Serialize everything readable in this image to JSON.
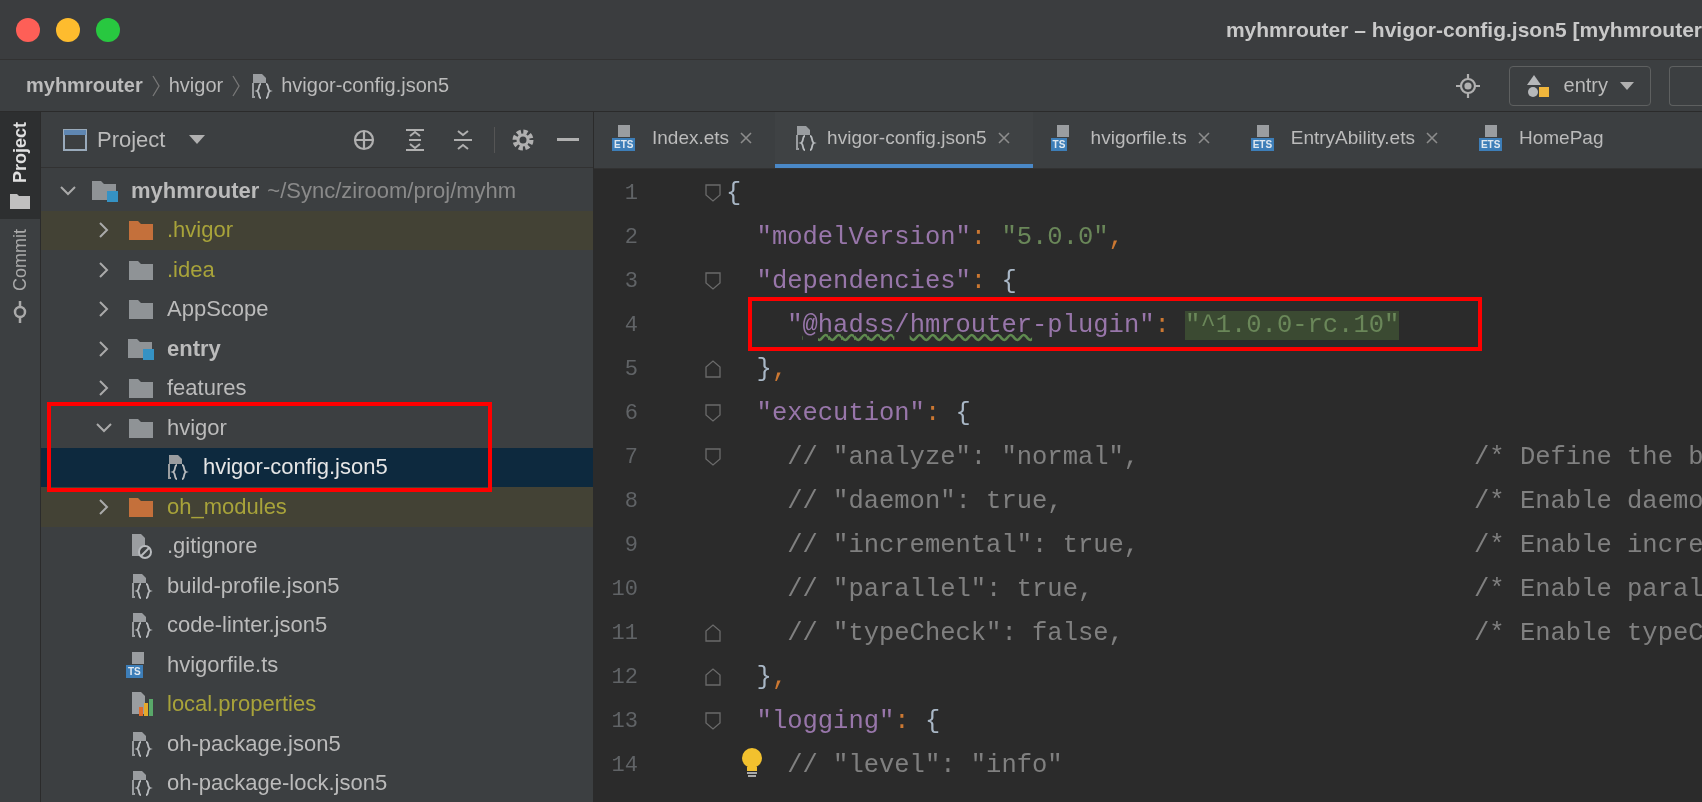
{
  "window": {
    "title": "myhmrouter – hvigor-config.json5 [myhmrouter"
  },
  "breadcrumbs": [
    {
      "label": "myhmrouter",
      "kind": "project"
    },
    {
      "label": "hvigor",
      "kind": "folder"
    },
    {
      "label": "hvigor-config.json5",
      "kind": "json"
    }
  ],
  "run_config": {
    "label": "entry"
  },
  "side_tabs": [
    {
      "label": "Project",
      "kind": "folder",
      "selected": true
    },
    {
      "label": "Commit",
      "kind": "commit",
      "selected": false
    }
  ],
  "project_panel": {
    "title": "Project"
  },
  "tree": [
    {
      "label": "myhmrouter",
      "path": "~/Sync/ziroom/proj/myhm",
      "kind": "module",
      "ignored": false,
      "highlighted": false,
      "selected": false,
      "expanded": true,
      "children": [
        {
          "label": ".hvigor",
          "kind": "excluded",
          "ignored": true,
          "highlighted": true,
          "selected": false,
          "expanded": false
        },
        {
          "label": ".idea",
          "kind": "folder",
          "ignored": true,
          "highlighted": false,
          "selected": false,
          "expanded": false
        },
        {
          "label": "AppScope",
          "kind": "folder",
          "ignored": false,
          "highlighted": false,
          "selected": false,
          "expanded": false
        },
        {
          "label": "entry",
          "kind": "module",
          "ignored": false,
          "highlighted": false,
          "selected": false,
          "expanded": false
        },
        {
          "label": "features",
          "kind": "folder",
          "ignored": false,
          "highlighted": false,
          "selected": false,
          "expanded": false
        },
        {
          "label": "hvigor",
          "kind": "folder",
          "ignored": false,
          "highlighted": false,
          "selected": false,
          "expanded": true,
          "children": [
            {
              "label": "hvigor-config.json5",
              "kind": "json",
              "ignored": false,
              "highlighted": false,
              "selected": true
            }
          ]
        },
        {
          "label": "oh_modules",
          "kind": "excluded",
          "ignored": true,
          "highlighted": true,
          "selected": false,
          "expanded": false
        },
        {
          "label": ".gitignore",
          "kind": "gitignore",
          "ignored": false,
          "highlighted": false,
          "selected": false
        },
        {
          "label": "build-profile.json5",
          "kind": "json",
          "ignored": false,
          "highlighted": false,
          "selected": false
        },
        {
          "label": "code-linter.json5",
          "kind": "json",
          "ignored": false,
          "highlighted": false,
          "selected": false
        },
        {
          "label": "hvigorfile.ts",
          "kind": "ts",
          "badge": "TS",
          "ignored": false,
          "highlighted": false,
          "selected": false
        },
        {
          "label": "local.properties",
          "kind": "properties",
          "ignored": true,
          "highlighted": false,
          "selected": false
        },
        {
          "label": "oh-package.json5",
          "kind": "json",
          "ignored": false,
          "highlighted": false,
          "selected": false
        },
        {
          "label": "oh-package-lock.json5",
          "kind": "json",
          "ignored": false,
          "highlighted": false,
          "selected": false
        }
      ]
    }
  ],
  "tabs": [
    {
      "label": "Index.ets",
      "kind": "ets",
      "badge": "ETS",
      "closable": true,
      "selected": false
    },
    {
      "label": "hvigor-config.json5",
      "kind": "json",
      "closable": true,
      "selected": true
    },
    {
      "label": "hvigorfile.ts",
      "kind": "ts",
      "badge": "TS",
      "closable": true,
      "selected": false
    },
    {
      "label": "EntryAbility.ets",
      "kind": "ets",
      "badge": "ETS",
      "closable": true,
      "selected": false
    },
    {
      "label": "HomePag",
      "kind": "ets",
      "badge": "ETS",
      "closable": false,
      "selected": false
    }
  ],
  "editor": {
    "lines": [
      {
        "number": "1",
        "fold_start": true,
        "tokens": [
          {
            "kind": "brace",
            "text": "{"
          }
        ]
      },
      {
        "number": "2",
        "tokens": [
          {
            "kind": "key",
            "text": "  \"modelVersion\""
          },
          {
            "kind": "punct",
            "text": ": "
          },
          {
            "kind": "string",
            "text": "\"5.0.0\""
          },
          {
            "kind": "punct",
            "text": ","
          }
        ]
      },
      {
        "number": "3",
        "fold_start": true,
        "tokens": [
          {
            "kind": "key",
            "text": "  \"dependencies\""
          },
          {
            "kind": "punct",
            "text": ": "
          },
          {
            "kind": "brace",
            "text": "{"
          }
        ]
      },
      {
        "number": "4",
        "tokens": [
          {
            "kind": "key",
            "text": "    \""
          },
          {
            "kind": "key",
            "text": "@hadss",
            "typo": true
          },
          {
            "kind": "key",
            "text": "/"
          },
          {
            "kind": "key",
            "text": "hmrouter",
            "typo": true
          },
          {
            "kind": "key",
            "text": "-plugin\""
          },
          {
            "kind": "punct",
            "text": ": "
          },
          {
            "kind": "string",
            "text": "\"^1.0.0-rc.10\"",
            "marked": true
          }
        ]
      },
      {
        "number": "5",
        "fold_end": true,
        "tokens": [
          {
            "kind": "brace",
            "text": "  }"
          },
          {
            "kind": "punct",
            "text": ","
          }
        ]
      },
      {
        "number": "6",
        "fold_start": true,
        "tokens": [
          {
            "kind": "key",
            "text": "  \"execution\""
          },
          {
            "kind": "punct",
            "text": ": "
          },
          {
            "kind": "brace",
            "text": "{"
          }
        ]
      },
      {
        "number": "7",
        "fold_start": true,
        "tokens": [
          {
            "kind": "comment",
            "text": "    // \"analyze\": \"normal\","
          }
        ],
        "note": "/* Define the b"
      },
      {
        "number": "8",
        "tokens": [
          {
            "kind": "comment",
            "text": "    // \"daemon\": true,"
          }
        ],
        "note": "/* Enable daemo"
      },
      {
        "number": "9",
        "tokens": [
          {
            "kind": "comment",
            "text": "    // \"incremental\": true,"
          }
        ],
        "note": "/* Enable incre"
      },
      {
        "number": "10",
        "tokens": [
          {
            "kind": "comment",
            "text": "    // \"parallel\": true,"
          }
        ],
        "note": "/* Enable paral"
      },
      {
        "number": "11",
        "fold_end": true,
        "tokens": [
          {
            "kind": "comment",
            "text": "    // \"typeCheck\": false,"
          }
        ],
        "note": "/* Enable typeC"
      },
      {
        "number": "12",
        "fold_end": true,
        "tokens": [
          {
            "kind": "brace",
            "text": "  }"
          },
          {
            "kind": "punct",
            "text": ","
          }
        ]
      },
      {
        "number": "13",
        "fold_start": true,
        "tokens": [
          {
            "kind": "key",
            "text": "  \"logging\""
          },
          {
            "kind": "punct",
            "text": ": "
          },
          {
            "kind": "brace",
            "text": "{"
          }
        ]
      },
      {
        "number": "14",
        "hint": true,
        "tokens": [
          {
            "kind": "comment",
            "text": "    // \"level\": \"info\""
          }
        ]
      }
    ]
  }
}
